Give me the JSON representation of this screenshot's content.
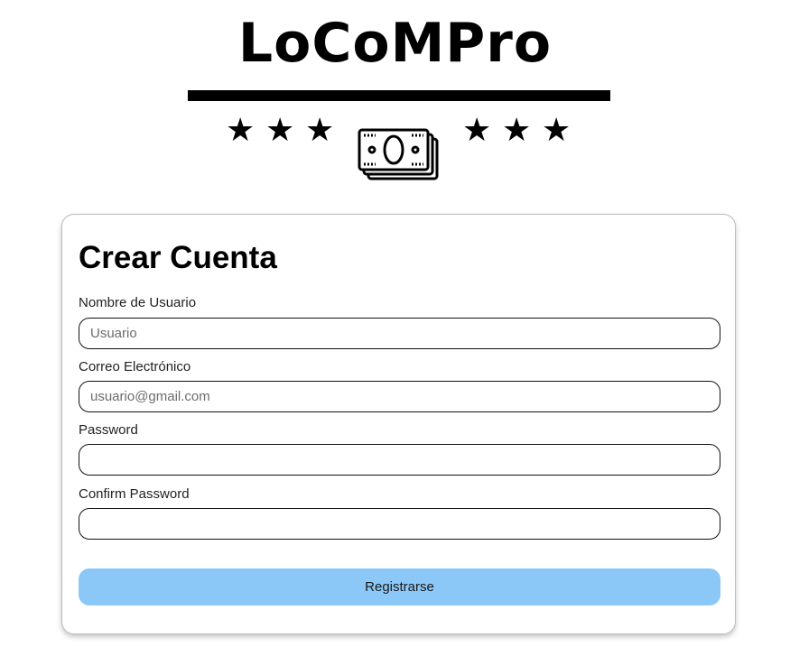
{
  "brand": {
    "title": "LoCoMPro",
    "stars_left": [
      "★",
      "★",
      "★"
    ],
    "stars_right": [
      "★",
      "★",
      "★"
    ],
    "emblem_icon": "money-bills-icon"
  },
  "form": {
    "title": "Crear Cuenta",
    "fields": [
      {
        "label": "Nombre de Usuario",
        "placeholder": "Usuario",
        "value": ""
      },
      {
        "label": "Correo Electrónico",
        "placeholder": "usuario@gmail.com",
        "value": ""
      },
      {
        "label": "Password",
        "placeholder": "",
        "value": ""
      },
      {
        "label": "Confirm Password",
        "placeholder": "",
        "value": ""
      }
    ],
    "submit_label": "Registrarse"
  },
  "colors": {
    "button_bg": "#8bc8f7",
    "text": "#000000",
    "border": "#111111"
  }
}
